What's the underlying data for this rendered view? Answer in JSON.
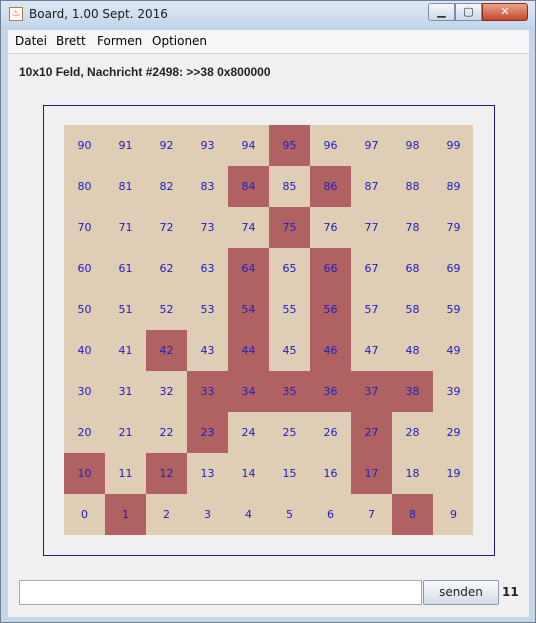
{
  "window": {
    "title": "Board, 1.00 Sept. 2016"
  },
  "menu": [
    "Datei",
    "Brett",
    "Formen",
    "Optionen"
  ],
  "status": "10x10 Feld, Nachricht #2498: >>38 0x800000",
  "board": {
    "rows": 10,
    "cols": 10,
    "cell_color": "#e0cdb5",
    "active_color": "#b06262",
    "number_color": "#2020c0",
    "active_cells": [
      1,
      8,
      10,
      12,
      17,
      23,
      27,
      33,
      34,
      35,
      36,
      37,
      38,
      42,
      44,
      46,
      54,
      56,
      64,
      66,
      75,
      84,
      86,
      95
    ]
  },
  "input": {
    "value": "",
    "placeholder": ""
  },
  "send_button": "senden",
  "counter": "11"
}
